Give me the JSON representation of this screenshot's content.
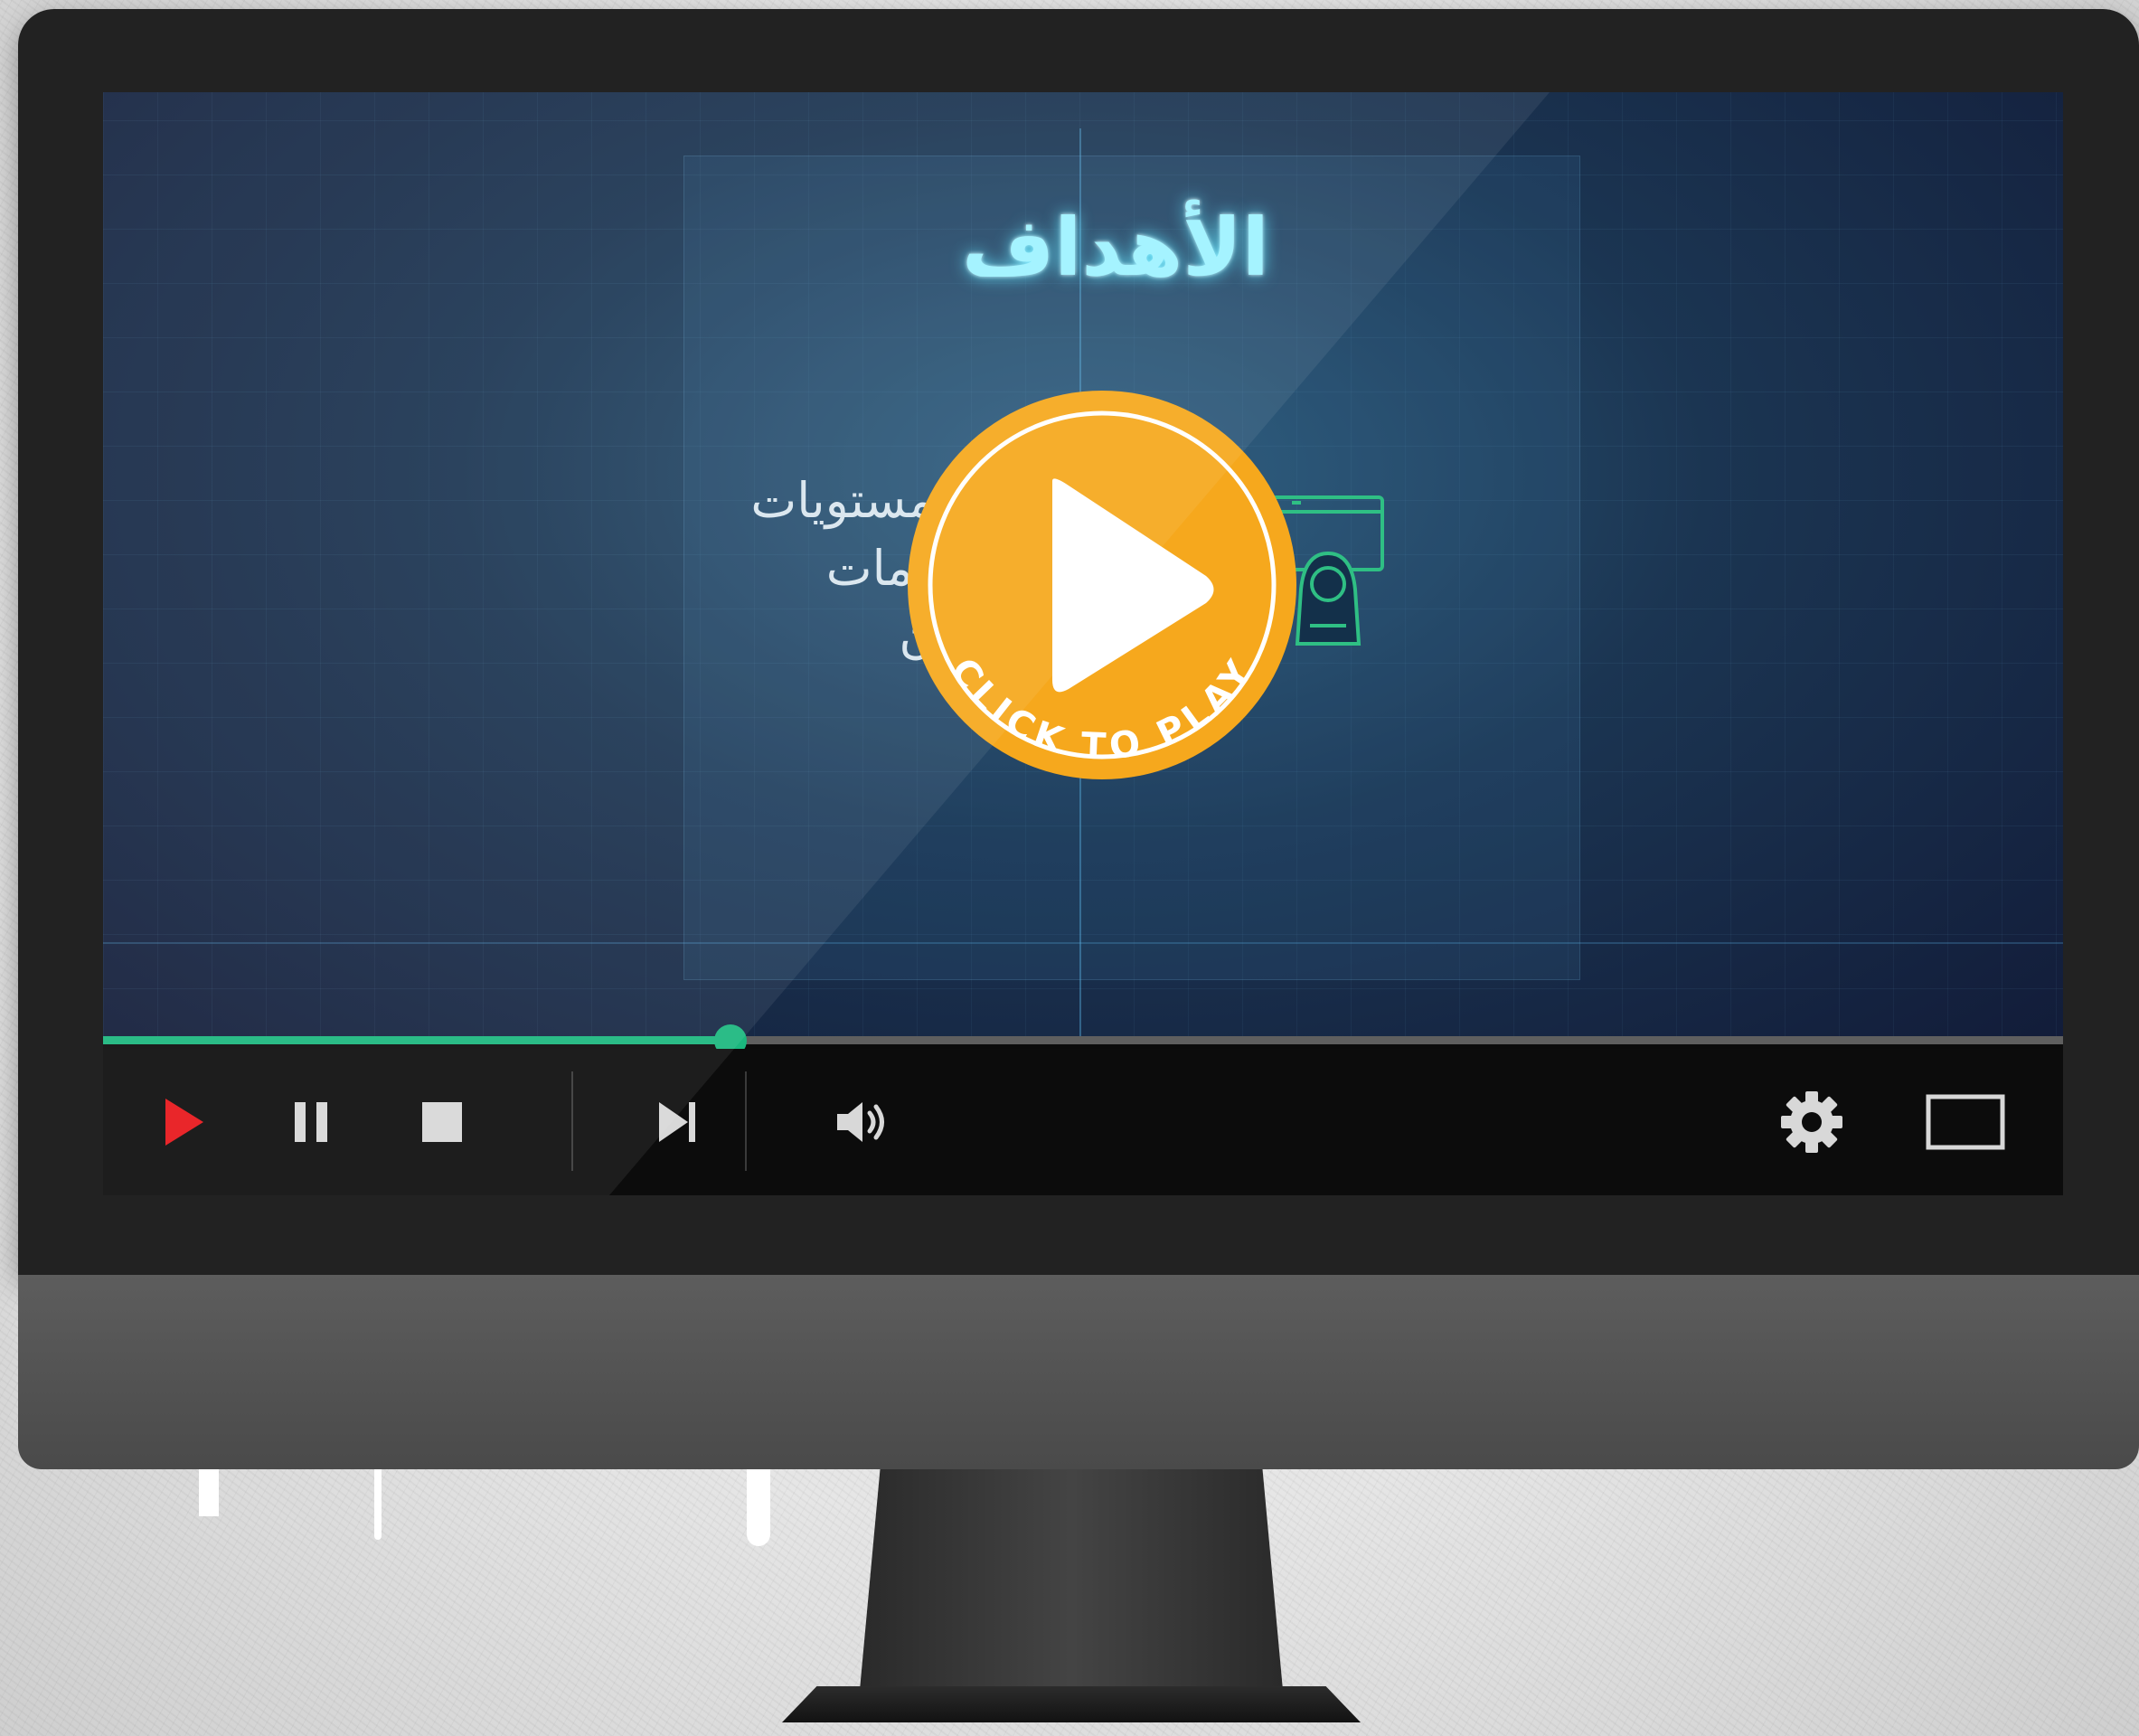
{
  "video": {
    "title": "الأهداف",
    "lines": [
      "مستويات",
      "دمات",
      "ن"
    ]
  },
  "player": {
    "overlay_label": "CLICK TO PLAY",
    "progress_fraction": 0.32,
    "accent_color": "#1bb77e",
    "overlay_color": "#f6a81d",
    "play_color": "#e8161a"
  },
  "controls": {
    "icons": [
      "play-icon",
      "pause-icon",
      "stop-icon",
      "next-track-icon",
      "volume-icon",
      "settings-icon",
      "fullscreen-icon"
    ]
  }
}
